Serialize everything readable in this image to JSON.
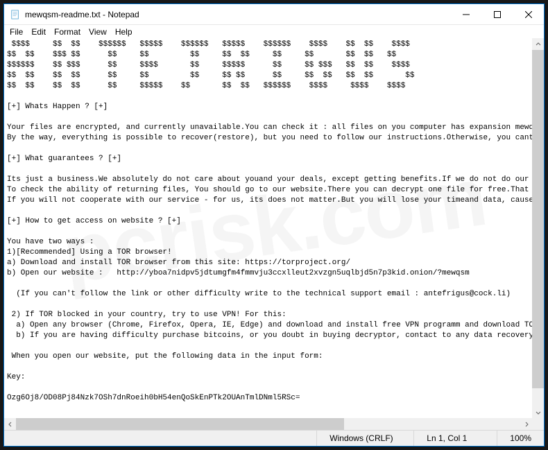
{
  "titlebar": {
    "title": "mewqsm-readme.txt - Notepad"
  },
  "menu": {
    "file": "File",
    "edit": "Edit",
    "format": "Format",
    "view": "View",
    "help": "Help"
  },
  "content": " $$$$     $$  $$    $$$$$$   $$$$$    $$$$$$   $$$$$    $$$$$$    $$$$    $$  $$    $$$$\n$$  $$    $$$ $$      $$     $$         $$     $$  $$     $$     $$       $$  $$   $$\n$$$$$$    $$ $$$      $$     $$$$       $$     $$$$$      $$     $$ $$$   $$  $$    $$$$\n$$  $$    $$  $$      $$     $$         $$     $$ $$      $$     $$  $$   $$  $$       $$\n$$  $$    $$  $$      $$     $$$$$    $$       $$  $$   $$$$$$    $$$$     $$$$    $$$$\n\n[+] Whats Happen ? [+]\n\nYour files are encrypted, and currently unavailable.You can check it : all files on you computer has expansion mewqsm.\nBy the way, everything is possible to recover(restore), but you need to follow our instructions.Otherwise, you cant re\n\n[+] What guarantees ? [+]\n\nIts just a business.We absolutely do not care about youand your deals, except getting benefits.If we do not do our wor\nTo check the ability of returning files, You should go to our website.There you can decrypt one file for free.That is \nIf you will not cooperate with our service - for us, its does not matter.But you will lose your timeand data, cause ju\n\n[+] How to get access on website ? [+]\n\nYou have two ways :\n1)[Recommended] Using a TOR browser!\na) Download and install TOR browser from this site: https://torproject.org/\nb) Open our website :   http://yboa7nidpv5jdtumgfm4fmmvju3ccxlleut2xvzgn5uqlbjd5n7p3kid.onion/?mewqsm\n\n  (If you can't follow the link or other difficulty write to the technical support email : antefrigus@cock.li)\n\n 2) If TOR blocked in your country, try to use VPN! For this:\n  a) Open any browser (Chrome, Firefox, Opera, IE, Edge) and download and install free VPN programm and download TOR br\n  b) If you are having difficulty purchase bitcoins, or you doubt in buying decryptor, contact to any data recovery co\n\n When you open our website, put the following data in the input form:\n\nKey:\n\nOzg6Oj8/OD08Pj84Nzk7OSh7dnRoeih0bH54enQoSkEnPTk2OUAnTmlDNml5RSc=\n\n\nExtension name :\n\n\nmewqsm",
  "statusbar": {
    "encoding": "Windows (CRLF)",
    "position": "Ln 1, Col 1",
    "zoom": "100%"
  },
  "watermark": "pcrisk.com"
}
